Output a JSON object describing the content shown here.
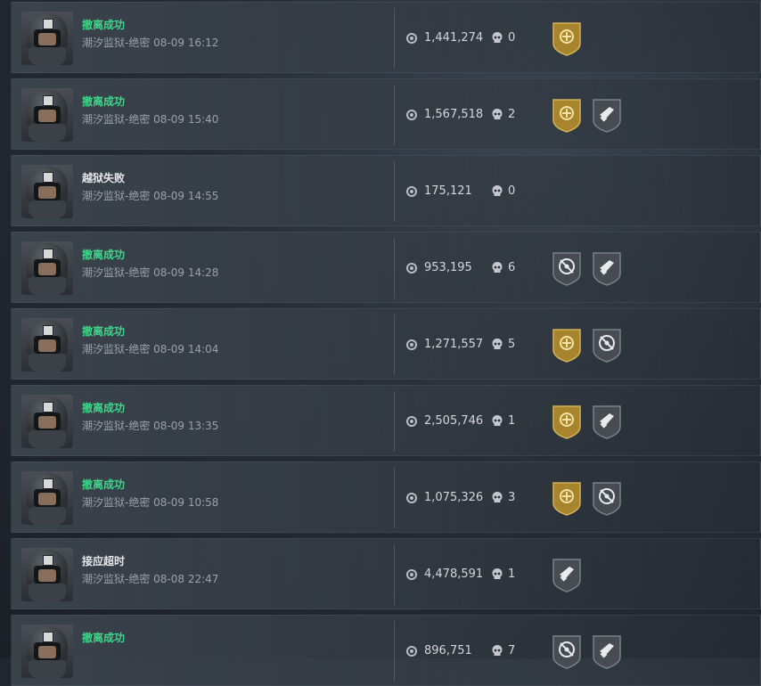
{
  "records": [
    {
      "status": "撤离成功",
      "status_type": "ok",
      "map": "潮汐监狱-绝密",
      "date": "08-09 16:12",
      "value": "1,441,274",
      "kills": "0",
      "badges": [
        "gold-crosshair-badge"
      ]
    },
    {
      "status": "撤离成功",
      "status_type": "ok",
      "map": "潮汐监狱-绝密",
      "date": "08-09 15:40",
      "value": "1,567,518",
      "kills": "2",
      "badges": [
        "gold-crosshair-badge",
        "gray-gun-badge"
      ]
    },
    {
      "status": "越狱失败",
      "status_type": "fail",
      "map": "潮汐监狱-绝密",
      "date": "08-09 14:55",
      "value": "175,121",
      "kills": "0",
      "badges": []
    },
    {
      "status": "撤离成功",
      "status_type": "ok",
      "map": "潮汐监狱-绝密",
      "date": "08-09 14:28",
      "value": "953,195",
      "kills": "6",
      "badges": [
        "gray-target-badge",
        "gray-gun-badge"
      ]
    },
    {
      "status": "撤离成功",
      "status_type": "ok",
      "map": "潮汐监狱-绝密",
      "date": "08-09 14:04",
      "value": "1,271,557",
      "kills": "5",
      "badges": [
        "gold-crosshair-badge",
        "gray-target-badge"
      ]
    },
    {
      "status": "撤离成功",
      "status_type": "ok",
      "map": "潮汐监狱-绝密",
      "date": "08-09 13:35",
      "value": "2,505,746",
      "kills": "1",
      "badges": [
        "gold-crosshair-badge",
        "gray-gun-badge"
      ]
    },
    {
      "status": "撤离成功",
      "status_type": "ok",
      "map": "潮汐监狱-绝密",
      "date": "08-09 10:58",
      "value": "1,075,326",
      "kills": "3",
      "badges": [
        "gold-crosshair-badge",
        "gray-target-badge"
      ]
    },
    {
      "status": "接应超时",
      "status_type": "fail",
      "map": "潮汐监狱-绝密",
      "date": "08-08 22:47",
      "value": "4,478,591",
      "kills": "1",
      "badges": [
        "gray-gun-badge"
      ]
    },
    {
      "status": "撤离成功",
      "status_type": "ok",
      "map": "",
      "date": "",
      "value": "896,751",
      "kills": "7",
      "badges": [
        "gray-target-badge",
        "gray-gun-badge"
      ]
    }
  ],
  "colors": {
    "success": "#3fd68a",
    "fail": "#e6e8ea",
    "gold_badge": "#b08a2e",
    "gray_badge": "#4a4f55"
  },
  "icons": {
    "value": "coin-icon",
    "kills": "skull-icon"
  }
}
